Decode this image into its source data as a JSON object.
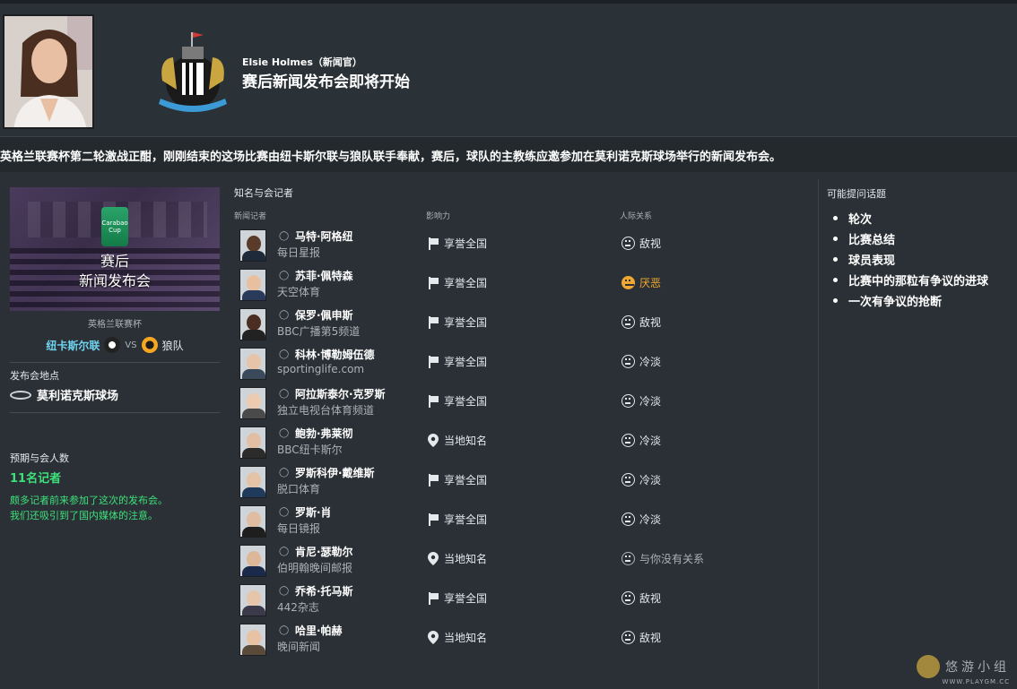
{
  "header": {
    "speaker": "Elsie Holmes（新闻官）",
    "headline": "赛后新闻发布会即将开始"
  },
  "intro": "英格兰联赛杯第二轮激战正酣，刚刚结束的这场比赛由纽卡斯尔联与狼队联手奉献，赛后，球队的主教练应邀参加在莫利诺克斯球场举行的新闻发布会。",
  "left": {
    "cup_badge": "Carabao Cup",
    "event_title_1": "赛后",
    "event_title_2": "新闻发布会",
    "competition": "英格兰联赛杯",
    "home": "纽卡斯尔联",
    "vs": "VS",
    "away": "狼队",
    "venue_label": "发布会地点",
    "venue": "莫利诺克斯球场",
    "attendance_label": "预期与会人数",
    "attendance_count": "11名记者",
    "attendance_note_1": "颇多记者前来参加了这次的发布会。",
    "attendance_note_2": "我们还吸引到了国内媒体的注意。"
  },
  "table": {
    "title": "知名与会记者",
    "col_reporter": "新闻记者",
    "col_influence": "影响力",
    "col_relationship": "人际关系",
    "rows": [
      {
        "name": "马特·阿格纽",
        "outlet": "每日星报",
        "influence": "享誉全国",
        "influence_icon": "flag-icon",
        "relationship": "敌视",
        "rel_type": "normal"
      },
      {
        "name": "苏菲·佩特森",
        "outlet": "天空体育",
        "influence": "享誉全国",
        "influence_icon": "flag-icon",
        "relationship": "厌恶",
        "rel_type": "warn"
      },
      {
        "name": "保罗·佩申斯",
        "outlet": "BBC广播第5频道",
        "influence": "享誉全国",
        "influence_icon": "flag-icon",
        "relationship": "敌视",
        "rel_type": "normal"
      },
      {
        "name": "科林·博勒姆伍德",
        "outlet": "sportinglife.com",
        "influence": "享誉全国",
        "influence_icon": "flag-icon",
        "relationship": "冷淡",
        "rel_type": "normal"
      },
      {
        "name": "阿拉斯泰尔·克罗斯",
        "outlet": "独立电视台体育频道",
        "influence": "享誉全国",
        "influence_icon": "flag-icon",
        "relationship": "冷淡",
        "rel_type": "normal"
      },
      {
        "name": "鲍勃·弗莱彻",
        "outlet": "BBC纽卡斯尔",
        "influence": "当地知名",
        "influence_icon": "pin-icon",
        "relationship": "冷淡",
        "rel_type": "normal"
      },
      {
        "name": "罗斯科伊·戴维斯",
        "outlet": "脱口体育",
        "influence": "享誉全国",
        "influence_icon": "flag-icon",
        "relationship": "冷淡",
        "rel_type": "normal"
      },
      {
        "name": "罗斯·肖",
        "outlet": "每日镜报",
        "influence": "享誉全国",
        "influence_icon": "flag-icon",
        "relationship": "冷淡",
        "rel_type": "normal"
      },
      {
        "name": "肯尼·瑟勒尔",
        "outlet": "伯明翰晚间邮报",
        "influence": "当地知名",
        "influence_icon": "pin-icon",
        "relationship": "与你没有关系",
        "rel_type": "none"
      },
      {
        "name": "乔希·托马斯",
        "outlet": "442杂志",
        "influence": "享誉全国",
        "influence_icon": "flag-icon",
        "relationship": "敌视",
        "rel_type": "normal"
      },
      {
        "name": "哈里·帕赫",
        "outlet": "晚间新闻",
        "influence": "当地知名",
        "influence_icon": "pin-icon",
        "relationship": "敌视",
        "rel_type": "normal"
      }
    ]
  },
  "topics": {
    "title": "可能提问话题",
    "items": [
      "轮次",
      "比赛总结",
      "球员表现",
      "比赛中的那粒有争议的进球",
      "一次有争议的抢断"
    ]
  },
  "watermark": {
    "text": "悠游小组",
    "sub": "WWW.PLAYGM.CC"
  },
  "colors": {
    "background": "#2a3035",
    "accent_green": "#3ee07a",
    "home_team": "#6fd3f0",
    "warn": "#f0a830"
  }
}
